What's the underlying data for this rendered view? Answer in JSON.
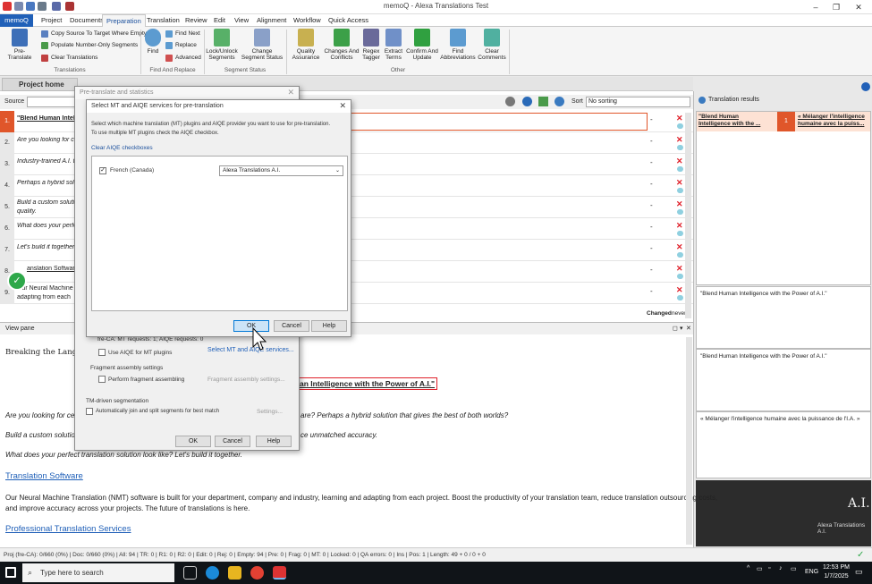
{
  "window": {
    "title": "memoQ - Alexa Translations Test"
  },
  "menu": {
    "tabs": [
      "memoQ",
      "Project",
      "Documents",
      "Preparation",
      "Translation",
      "Review",
      "Edit",
      "View",
      "Alignment",
      "Workflow",
      "Quick Access"
    ],
    "active": "Preparation"
  },
  "ribbon": {
    "pretranslate": "Pre-Translate",
    "copy_source": "Copy Source To Target Where Empty",
    "populate": "Populate Number-Only Segments",
    "clear_translations": "Clear Translations",
    "group_translations": "Translations",
    "find": "Find",
    "find_next": "Find Next",
    "replace": "Replace",
    "advanced": "Advanced",
    "group_find": "Find And Replace",
    "lock_unlock": "Lock/Unlock Segments",
    "change_status": "Change Segment Status",
    "group_status": "Segment Status",
    "quality": "Quality Assurance",
    "changes": "Changes And Conflicts",
    "regex": "Regex Tagger",
    "extract": "Extract Terms",
    "confirm": "Confirm And Update",
    "abbrev": "Find Abbreviations",
    "clear_comments": "Clear Comments",
    "group_other": "Other"
  },
  "project_tab": "Project home",
  "editor": {
    "source_label": "Source",
    "sort_label": "Sort",
    "sort_value": "No sorting",
    "segments": [
      {
        "num": "1.",
        "text": "\"Blend Human Intel"
      },
      {
        "num": "2.",
        "text": "Are you looking for ce"
      },
      {
        "num": "3.",
        "text": "Industry-trained A.I. t"
      },
      {
        "num": "4.",
        "text": "Perhaps a hybrid solu"
      },
      {
        "num": "5.",
        "text": "Build a custom soluti"
      },
      {
        "num": "6.",
        "text": "What does your perfe"
      },
      {
        "num": "7.",
        "text": "Let's build it together."
      },
      {
        "num": "8.",
        "text": "anslation Software"
      },
      {
        "num": "9.",
        "text": "Our Neural Machine T"
      }
    ],
    "seg5_line2": "quality.",
    "seg9_line2": "adapting from each",
    "dash": "-",
    "changed": "Changed",
    "never": "never"
  },
  "results": {
    "title": "Translation results",
    "src": "\"Blend Human Intelligence with the ...",
    "num": "1",
    "tgt": "« Mélanger l'intelligence humaine avec la puiss...",
    "box1": "\"Blend Human Intelligence with the Power of A.I.\"",
    "box2": "\"Blend Human Intelligence with the Power of A.I.\"",
    "box3": "« Mélanger l'intelligence humaine avec la puissance de l'I.A. »",
    "logo": "A.I.",
    "brand": "Alexa Translations A.I."
  },
  "viewpane": {
    "title": "View pane",
    "h1": "Breaking the Language",
    "highlight": "an Intelligence with the Power of A.I.\"",
    "p1": "Are you looking for cert",
    "p1b": "are? Perhaps a hybrid solution that gives the best of both worlds?",
    "p2": "Build a custom solution",
    "p2b": "ce unmatched accuracy.",
    "p3": "What does your perfect translation solution look like? Let's build it together.",
    "h2": "Translation Software",
    "p4": "Our Neural Machine Translation (NMT) software is built for your department, company and industry, learning and adapting from each project. Boost the productivity of your translation team, reduce translation outsourcing costs,",
    "p4b": "and improve accuracy across your projects. The future of translations is here.",
    "h3": "Professional Translation Services"
  },
  "dialog_back": {
    "title": "Pre-translate and statistics",
    "mt_req": "fre-CA: MT requests: 1; AIQE requests: 0",
    "select_mt": "Select MT and AIQE services...",
    "use_aiqe": "Use AIQE for MT plugins",
    "frag_title": "Fragment assembly settings",
    "frag": "Perform fragment assembling",
    "frag_settings": "Fragment assembly settings...",
    "tm_title": "TM-driven segmentation",
    "tm": "Automatically join and split segments for best match",
    "settings": "Settings...",
    "ok": "OK",
    "cancel": "Cancel",
    "help": "Help"
  },
  "dialog_front": {
    "title": "Select MT and AIQE services for pre-translation",
    "desc1": "Select which machine translation (MT) plugins and AIQE provider you want to use for pre-translation.",
    "desc2": "To use multiple MT plugins check the AIQE checkbox.",
    "clear": "Clear AIQE checkboxes",
    "lang": "French (Canada)",
    "provider": "Alexa Translations A.I.",
    "ok": "OK",
    "cancel": "Cancel",
    "help": "Help"
  },
  "status": {
    "text": "Proj (fre-CA): 0/660 (0%) | Doc: 0/660 (0%) | All: 94 | TR: 0 | R1: 0 | R2: 0 | Edit: 0 | Rej: 0 | Empty: 94 | Pre: 0 | Frag: 0 | MT: 0 | Locked: 0 | QA errors: 0 | Ins | Pos: 1 | Length: 49 + 0 / 0 + 0"
  },
  "taskbar": {
    "search": "Type here to search",
    "lang": "ENG",
    "time": "12:53 PM",
    "date": "1/7/2025"
  },
  "colors": {
    "accent": "#2060b8",
    "current_seg": "#e0562a",
    "error_red": "#e0202a"
  }
}
